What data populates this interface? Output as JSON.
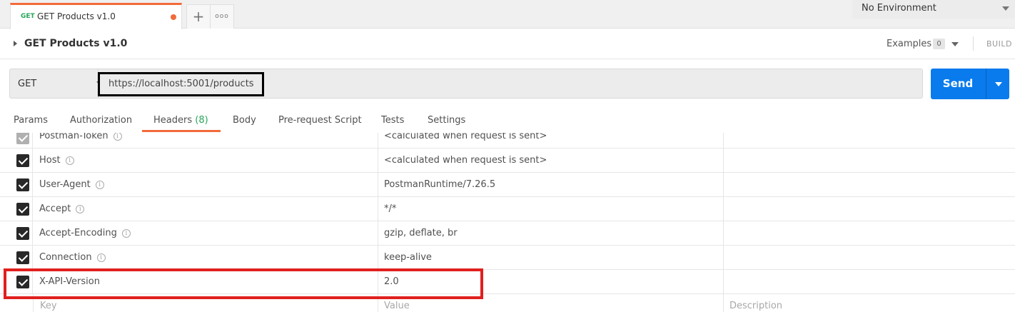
{
  "tab": {
    "method": "GET",
    "name": "GET Products v1.0",
    "plus": "+",
    "more": "ooo"
  },
  "environment": {
    "label": "No Environment"
  },
  "request": {
    "title": "GET Products v1.0",
    "examples_label": "Examples",
    "examples_count": "0",
    "build_label": "BUILD",
    "method": "GET",
    "url": "https://localhost:5001/products",
    "send_label": "Send"
  },
  "subtabs": {
    "params": "Params",
    "authorization": "Authorization",
    "headers": "Headers",
    "headers_count": "(8)",
    "body": "Body",
    "prerequest": "Pre-request Script",
    "tests": "Tests",
    "settings": "Settings"
  },
  "headers": [
    {
      "key": "Postman-Token",
      "value": "<calculated when request is sent>"
    },
    {
      "key": "Host",
      "value": "<calculated when request is sent>"
    },
    {
      "key": "User-Agent",
      "value": "PostmanRuntime/7.26.5"
    },
    {
      "key": "Accept",
      "value": "*/*"
    },
    {
      "key": "Accept-Encoding",
      "value": "gzip, deflate, br"
    },
    {
      "key": "Connection",
      "value": "keep-alive"
    },
    {
      "key": "X-API-Version",
      "value": "2.0"
    }
  ],
  "placeholders": {
    "key": "Key",
    "value": "Value",
    "description": "Description"
  },
  "icons": {
    "info": "i"
  }
}
